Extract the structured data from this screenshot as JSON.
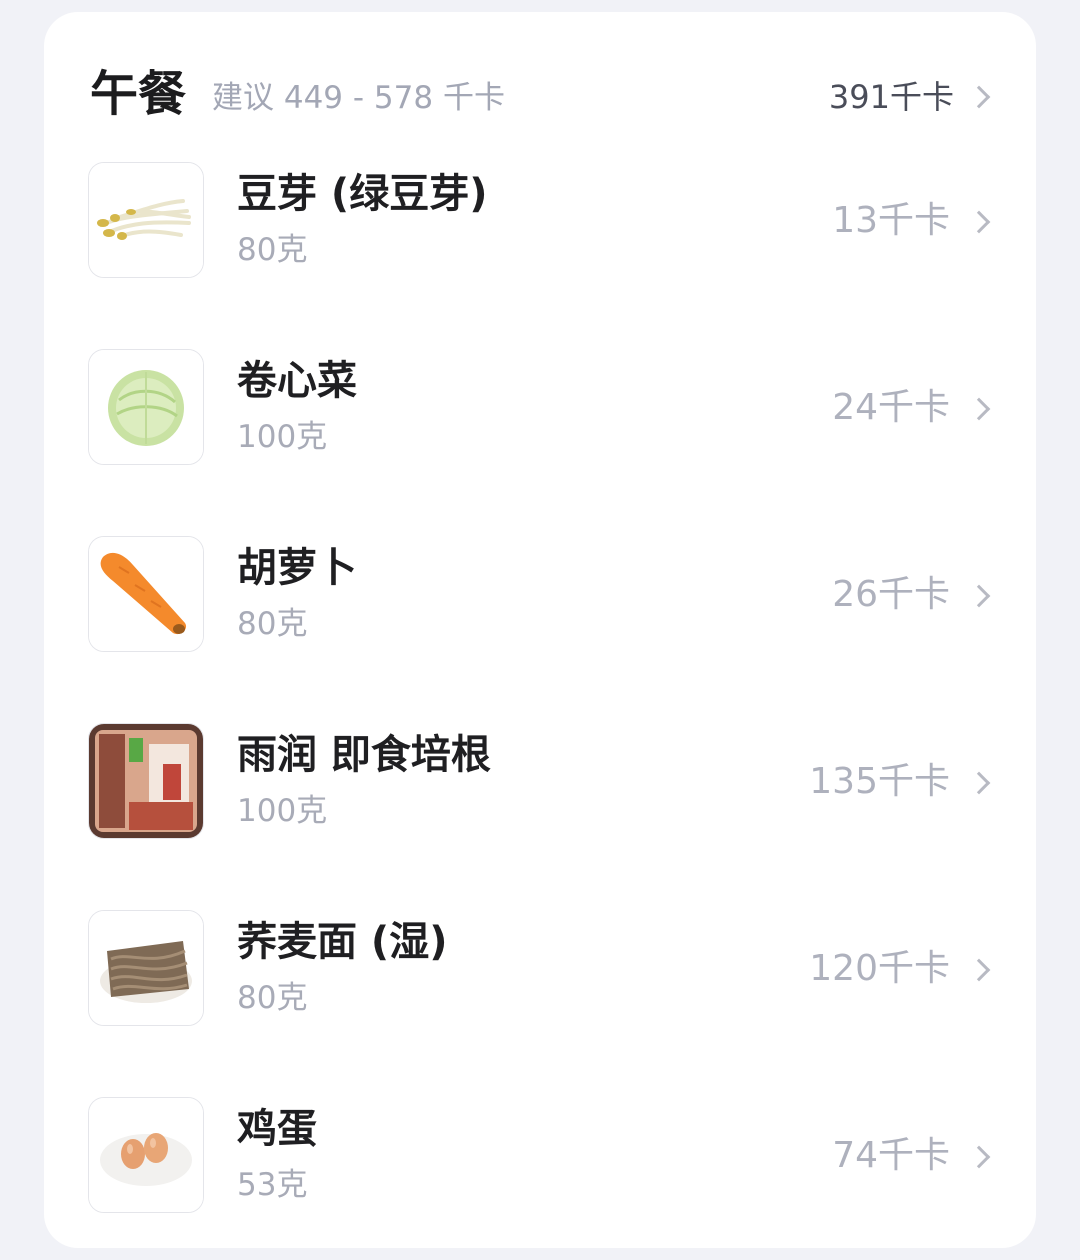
{
  "meal": {
    "title": "午餐",
    "suggestion": "建议 449 - 578 千卡",
    "total_kcal": "391千卡"
  },
  "items": [
    {
      "name": "豆芽 (绿豆芽)",
      "weight": "80克",
      "kcal": "13千卡",
      "image": "bean-sprouts-image"
    },
    {
      "name": "卷心菜",
      "weight": "100克",
      "kcal": "24千卡",
      "image": "cabbage-image"
    },
    {
      "name": "胡萝卜",
      "weight": "80克",
      "kcal": "26千卡",
      "image": "carrot-image"
    },
    {
      "name": "雨润 即食培根",
      "weight": "100克",
      "kcal": "135千卡",
      "image": "bacon-package-image"
    },
    {
      "name": "荞麦面 (湿)",
      "weight": "80克",
      "kcal": "120千卡",
      "image": "buckwheat-noodles-image"
    },
    {
      "name": "鸡蛋",
      "weight": "53克",
      "kcal": "74千卡",
      "image": "eggs-image"
    }
  ],
  "icons": {
    "chevron": "chevron-right-icon"
  },
  "colors": {
    "background": "#f1f2f7",
    "card": "#ffffff",
    "title": "#1c1c1e",
    "muted": "#a8abb7"
  }
}
